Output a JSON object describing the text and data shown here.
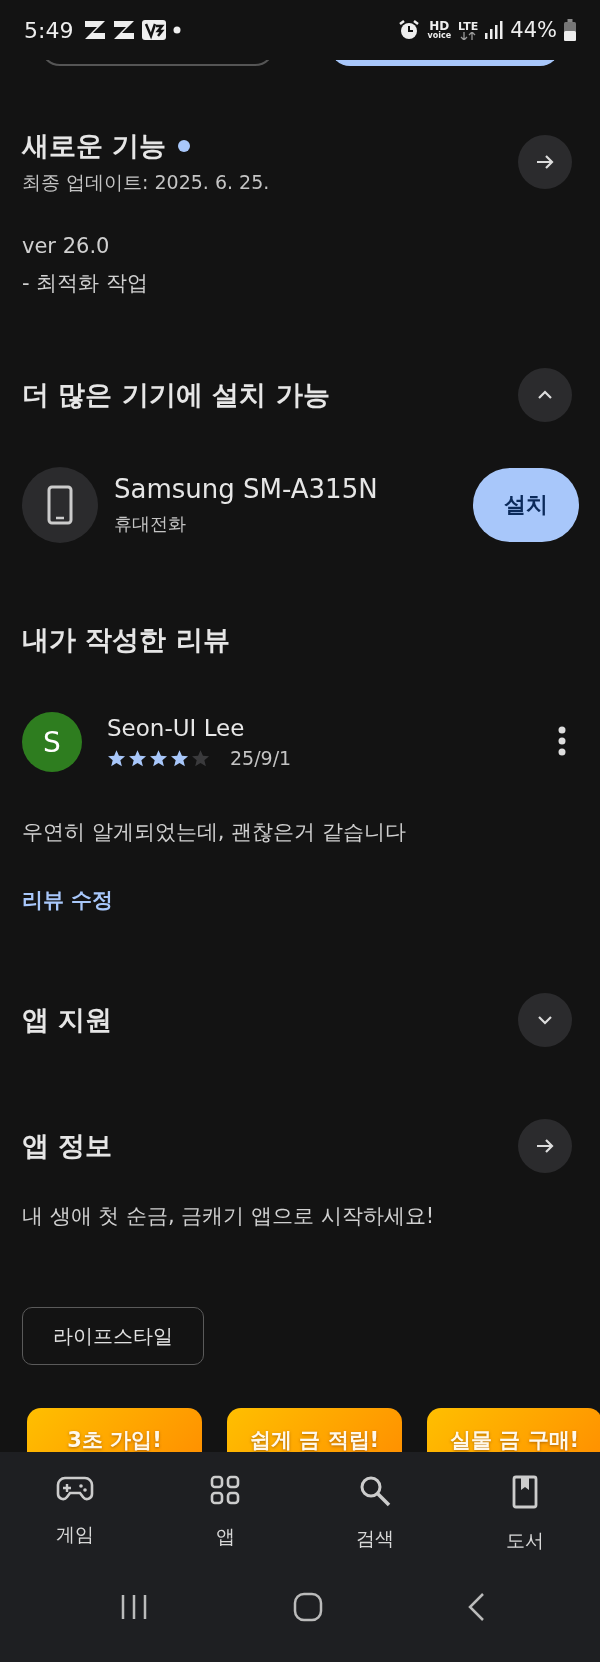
{
  "status_bar": {
    "time": "5:49",
    "hd": "HD",
    "voice": "voice",
    "lte": "LTE",
    "battery": "44%"
  },
  "whats_new": {
    "title": "새로운 기능",
    "new_dot": true,
    "updated": "최종 업데이트: 2025. 6. 25.",
    "notes": [
      "ver 26.0",
      "- 최적화 작업"
    ]
  },
  "more_devices": {
    "title": "더 많은 기기에 설치 가능",
    "expanded": true,
    "devices": [
      {
        "name": "Samsung SM-A315N",
        "type": "휴대전화",
        "button": "설치"
      }
    ]
  },
  "my_review": {
    "title": "내가 작성한 리뷰",
    "author": "Seon-UI Lee",
    "initial": "S",
    "stars": 4,
    "date": "25/9/1",
    "text": "우연히 알게되었는데, 괜찮은거 같습니다",
    "edit_link": "리뷰 수정"
  },
  "app_support": {
    "title": "앱 지원",
    "expanded": false
  },
  "app_info": {
    "title": "앱 정보",
    "description": "내 생애 첫 순금, 금캐기 앱으로 시작하세요!",
    "chips": [
      "라이프스타일"
    ]
  },
  "promo_cards": [
    "3초 가입!",
    "쉽게 금 적립!",
    "실물 금 구매!"
  ],
  "bottom_nav": [
    {
      "label": "게임"
    },
    {
      "label": "앱"
    },
    {
      "label": "검색"
    },
    {
      "label": "도서"
    }
  ]
}
